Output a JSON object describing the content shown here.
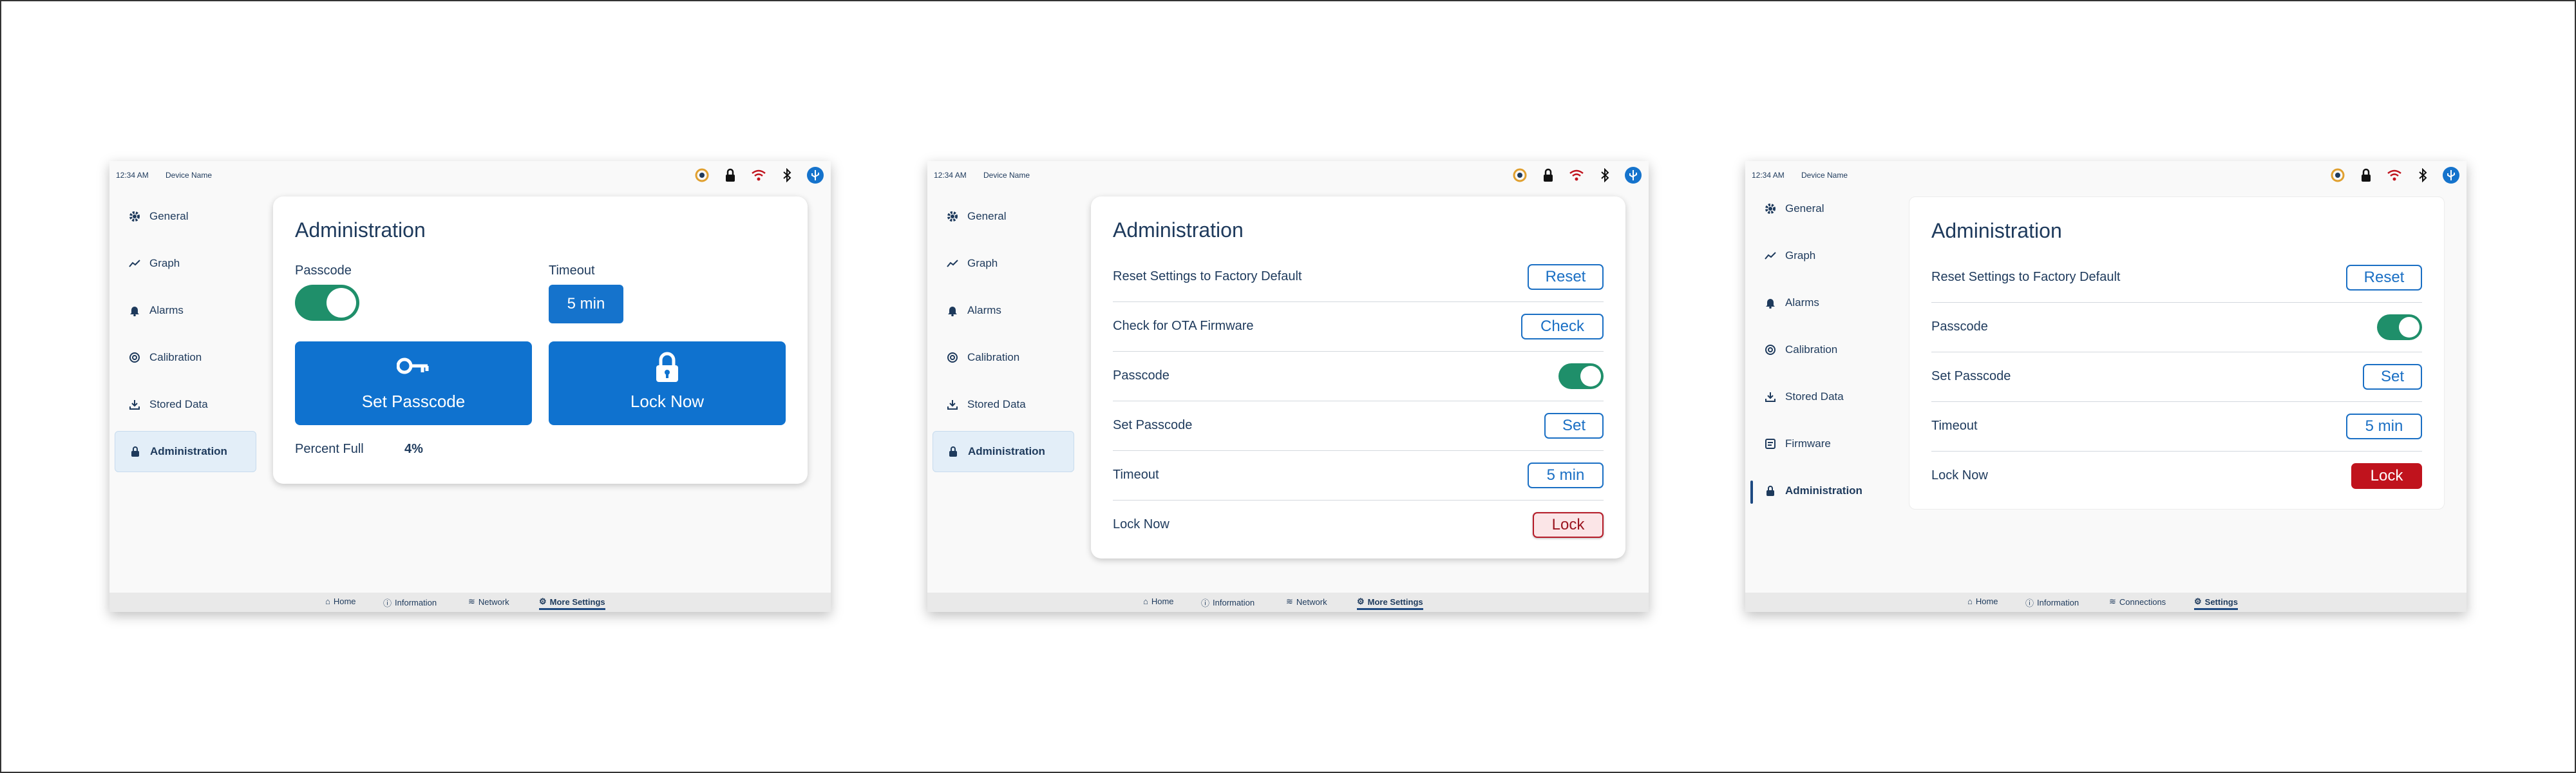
{
  "status": {
    "time": "12:34 AM",
    "device_name": "Device Name"
  },
  "colors": {
    "accent": "#1573cc",
    "toggle_on": "#1f8f6a",
    "lock_red": "#c0131d",
    "navy": "#1e3a5c"
  },
  "status_icons": [
    "battery-icon",
    "lock-icon",
    "wifi-icon",
    "bluetooth-icon",
    "usb-icon"
  ],
  "sidebar_a": [
    "General",
    "Graph",
    "Alarms",
    "Calibration",
    "Stored Data",
    "Administration"
  ],
  "sidebar_c": [
    "General",
    "Graph",
    "Alarms",
    "Calibration",
    "Stored Data",
    "Firmware",
    "Administration"
  ],
  "bottom_a": [
    "Home",
    "Information",
    "Network",
    "More Settings"
  ],
  "bottom_c": [
    "Home",
    "Information",
    "Connections",
    "Settings"
  ],
  "panel1": {
    "title": "Administration",
    "passcode_label": "Passcode",
    "timeout_label": "Timeout",
    "timeout_value": "5 min",
    "set_passcode": "Set Passcode",
    "lock_now": "Lock Now",
    "percent_label": "Percent Full",
    "percent_value": "4%",
    "passcode_on": true
  },
  "panel2": {
    "title": "Administration",
    "rows": [
      {
        "label": "Reset Settings to Factory Default",
        "button": "Reset"
      },
      {
        "label": "Check for OTA Firmware",
        "button": "Check"
      },
      {
        "label": "Passcode",
        "toggle": true
      },
      {
        "label": "Set Passcode",
        "button": "Set"
      },
      {
        "label": "Timeout",
        "button": "5 min"
      },
      {
        "label": "Lock Now",
        "button": "Lock"
      }
    ]
  },
  "panel3": {
    "title": "Administration",
    "rows": [
      {
        "label": "Reset Settings to Factory Default",
        "button": "Reset"
      },
      {
        "label": "Passcode",
        "toggle": true
      },
      {
        "label": "Set Passcode",
        "button": "Set"
      },
      {
        "label": "Timeout",
        "button": "5 min"
      },
      {
        "label": "Lock Now",
        "button": "Lock"
      }
    ]
  }
}
